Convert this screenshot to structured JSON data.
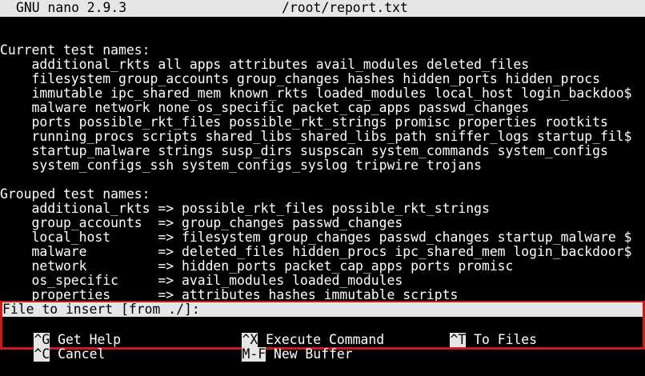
{
  "titlebar": {
    "app": "GNU nano 2.9.3",
    "filename": "/root/report.txt"
  },
  "content_lines": [
    "Current test names:",
    "    additional_rkts all apps attributes avail_modules deleted_files",
    "    filesystem group_accounts group_changes hashes hidden_ports hidden_procs",
    "    immutable ipc_shared_mem known_rkts loaded_modules local_host login_backdoo$",
    "    malware network none os_specific packet_cap_apps passwd_changes",
    "    ports possible_rkt_files possible_rkt_strings promisc properties rootkits",
    "    running_procs scripts shared_libs shared_libs_path sniffer_logs startup_fil$",
    "    startup_malware strings susp_dirs suspscan system_commands system_configs",
    "    system_configs_ssh system_configs_syslog tripwire trojans",
    "",
    "Grouped test names:",
    "    additional_rkts => possible_rkt_files possible_rkt_strings",
    "    group_accounts  => group_changes passwd_changes",
    "    local_host      => filesystem group_changes passwd_changes startup_malware $",
    "    malware         => deleted_files hidden_procs ipc_shared_mem login_backdoor$",
    "    network         => hidden_ports packet_cap_apps ports promisc",
    "    os_specific     => avail_modules loaded_modules",
    "    properties      => attributes hashes immutable scripts"
  ],
  "prompt": "File to insert [from ./]:",
  "shortcuts": [
    {
      "key": "^G",
      "label": " Get Help"
    },
    {
      "key": "^X",
      "label": " Execute Command"
    },
    {
      "key": "^T",
      "label": " To Files"
    },
    {
      "key": "^C",
      "label": " Cancel"
    },
    {
      "key": "M-F",
      "label": " New Buffer"
    }
  ]
}
